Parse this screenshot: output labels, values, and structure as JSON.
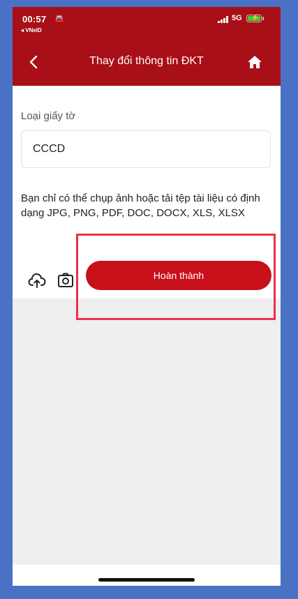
{
  "status": {
    "time": "00:57",
    "back_app": "◂ VNeID",
    "network": "5G"
  },
  "nav": {
    "title": "Thay đổi thông tin ĐKT",
    "back_icon": "chevron-left-icon",
    "home_icon": "home-icon"
  },
  "form": {
    "label": "Loại giấy tờ",
    "value": "CCCD",
    "hint": "Bạn chỉ có thể chụp ảnh hoặc tải tệp tài liệu có định dạng JPG, PNG, PDF, DOC, DOCX, XLS, XLSX"
  },
  "actions": {
    "upload_icon": "cloud-upload-icon",
    "camera_icon": "camera-icon",
    "complete_label": "Hoàn thành"
  },
  "colors": {
    "brand": "#a80f16",
    "button": "#c8101a",
    "highlight": "#e8324a",
    "background": "#4a72c4"
  }
}
